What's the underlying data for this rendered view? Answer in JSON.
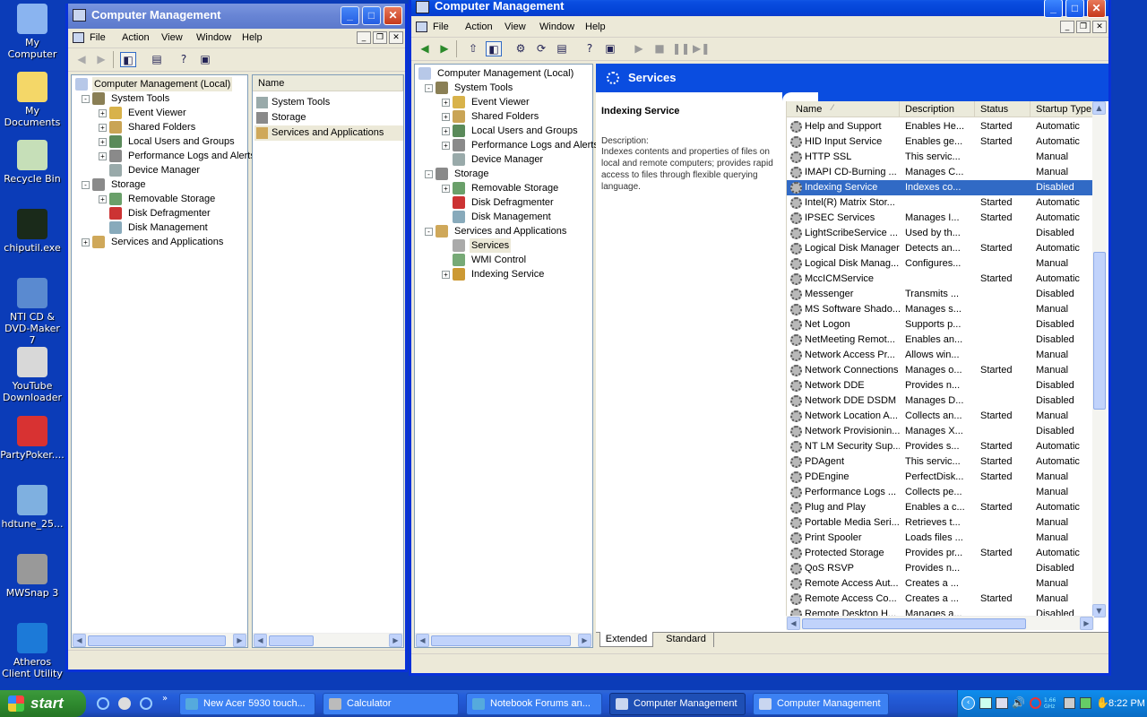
{
  "desktop": {
    "icons": [
      {
        "label": "My Computer"
      },
      {
        "label": "My Documents"
      },
      {
        "label": "Recycle Bin"
      },
      {
        "label": "chiputil.exe"
      },
      {
        "label": "NTI CD & DVD-Maker 7"
      },
      {
        "label": "YouTube Downloader"
      },
      {
        "label": "PartyPoker...."
      },
      {
        "label": "hdtune_25..."
      },
      {
        "label": "MWSnap 3"
      },
      {
        "label": "Atheros Client Utility"
      }
    ]
  },
  "window_back": {
    "title": "Computer Management",
    "menu": [
      "File",
      "Action",
      "View",
      "Window",
      "Help"
    ],
    "tree": [
      {
        "label": "Computer Management (Local)",
        "level": 0,
        "exp": ""
      },
      {
        "label": "System Tools",
        "level": 1,
        "exp": "-"
      },
      {
        "label": "Event Viewer",
        "level": 2,
        "exp": "+"
      },
      {
        "label": "Shared Folders",
        "level": 2,
        "exp": "+"
      },
      {
        "label": "Local Users and Groups",
        "level": 2,
        "exp": "+"
      },
      {
        "label": "Performance Logs and Alerts",
        "level": 2,
        "exp": "+"
      },
      {
        "label": "Device Manager",
        "level": 2,
        "exp": ""
      },
      {
        "label": "Storage",
        "level": 1,
        "exp": "-"
      },
      {
        "label": "Removable Storage",
        "level": 2,
        "exp": "+"
      },
      {
        "label": "Disk Defragmenter",
        "level": 2,
        "exp": ""
      },
      {
        "label": "Disk Management",
        "level": 2,
        "exp": ""
      },
      {
        "label": "Services and Applications",
        "level": 1,
        "exp": "+"
      }
    ],
    "list_header": "Name",
    "list": [
      "System Tools",
      "Storage",
      "Services and Applications"
    ]
  },
  "window_front": {
    "title": "Computer Management",
    "menu": [
      "File",
      "Action",
      "View",
      "Window",
      "Help"
    ],
    "tree": [
      {
        "label": "Computer Management (Local)",
        "level": 0,
        "exp": ""
      },
      {
        "label": "System Tools",
        "level": 1,
        "exp": "-"
      },
      {
        "label": "Event Viewer",
        "level": 2,
        "exp": "+"
      },
      {
        "label": "Shared Folders",
        "level": 2,
        "exp": "+"
      },
      {
        "label": "Local Users and Groups",
        "level": 2,
        "exp": "+"
      },
      {
        "label": "Performance Logs and Alerts",
        "level": 2,
        "exp": "+"
      },
      {
        "label": "Device Manager",
        "level": 2,
        "exp": ""
      },
      {
        "label": "Storage",
        "level": 1,
        "exp": "-"
      },
      {
        "label": "Removable Storage",
        "level": 2,
        "exp": "+"
      },
      {
        "label": "Disk Defragmenter",
        "level": 2,
        "exp": ""
      },
      {
        "label": "Disk Management",
        "level": 2,
        "exp": ""
      },
      {
        "label": "Services and Applications",
        "level": 1,
        "exp": "-"
      },
      {
        "label": "Services",
        "level": 2,
        "exp": ""
      },
      {
        "label": "WMI Control",
        "level": 2,
        "exp": ""
      },
      {
        "label": "Indexing Service",
        "level": 2,
        "exp": "+"
      }
    ],
    "services_title": "Services",
    "detail": {
      "name": "Indexing Service",
      "desc_label": "Description:",
      "desc_text": "Indexes contents and properties of files on local and remote computers; provides rapid access to files through flexible querying language."
    },
    "columns": [
      "Name",
      "Description",
      "Status",
      "Startup Type"
    ],
    "services": [
      [
        "Help and Support",
        "Enables He...",
        "Started",
        "Automatic"
      ],
      [
        "HID Input Service",
        "Enables ge...",
        "Started",
        "Automatic"
      ],
      [
        "HTTP SSL",
        "This servic...",
        "",
        "Manual"
      ],
      [
        "IMAPI CD-Burning ...",
        "Manages C...",
        "",
        "Manual"
      ],
      [
        "Indexing Service",
        "Indexes co...",
        "",
        "Disabled"
      ],
      [
        "Intel(R) Matrix Stor...",
        "",
        "Started",
        "Automatic"
      ],
      [
        "IPSEC Services",
        "Manages I...",
        "Started",
        "Automatic"
      ],
      [
        "LightScribeService ...",
        "Used by th...",
        "",
        "Disabled"
      ],
      [
        "Logical Disk Manager",
        "Detects an...",
        "Started",
        "Automatic"
      ],
      [
        "Logical Disk Manag...",
        "Configures...",
        "",
        "Manual"
      ],
      [
        "MccICMService",
        "",
        "Started",
        "Automatic"
      ],
      [
        "Messenger",
        "Transmits ...",
        "",
        "Disabled"
      ],
      [
        "MS Software Shado...",
        "Manages s...",
        "",
        "Manual"
      ],
      [
        "Net Logon",
        "Supports p...",
        "",
        "Disabled"
      ],
      [
        "NetMeeting Remot...",
        "Enables an...",
        "",
        "Disabled"
      ],
      [
        "Network Access Pr...",
        "Allows win...",
        "",
        "Manual"
      ],
      [
        "Network Connections",
        "Manages o...",
        "Started",
        "Manual"
      ],
      [
        "Network DDE",
        "Provides n...",
        "",
        "Disabled"
      ],
      [
        "Network DDE DSDM",
        "Manages D...",
        "",
        "Disabled"
      ],
      [
        "Network Location A...",
        "Collects an...",
        "Started",
        "Manual"
      ],
      [
        "Network Provisionin...",
        "Manages X...",
        "",
        "Disabled"
      ],
      [
        "NT LM Security Sup...",
        "Provides s...",
        "Started",
        "Automatic"
      ],
      [
        "PDAgent",
        "This servic...",
        "Started",
        "Automatic"
      ],
      [
        "PDEngine",
        "PerfectDisk...",
        "Started",
        "Manual"
      ],
      [
        "Performance Logs ...",
        "Collects pe...",
        "",
        "Manual"
      ],
      [
        "Plug and Play",
        "Enables a c...",
        "Started",
        "Automatic"
      ],
      [
        "Portable Media Seri...",
        "Retrieves t...",
        "",
        "Manual"
      ],
      [
        "Print Spooler",
        "Loads files ...",
        "",
        "Manual"
      ],
      [
        "Protected Storage",
        "Provides pr...",
        "Started",
        "Automatic"
      ],
      [
        "QoS RSVP",
        "Provides n...",
        "",
        "Disabled"
      ],
      [
        "Remote Access Aut...",
        "Creates a ...",
        "",
        "Manual"
      ],
      [
        "Remote Access Co...",
        "Creates a ...",
        "Started",
        "Manual"
      ],
      [
        "Remote Desktop H...",
        "Manages a...",
        "",
        "Disabled"
      ]
    ],
    "tabs": [
      "Extended",
      "Standard"
    ]
  },
  "taskbar": {
    "start": "start",
    "tasks": [
      {
        "label": "New Acer 5930 touch..."
      },
      {
        "label": "Calculator"
      },
      {
        "label": "Notebook Forums an..."
      },
      {
        "label": "Computer Management"
      },
      {
        "label": "Computer Management"
      }
    ],
    "clock": "8:22 PM",
    "tray_cpu": "1.66 GHz"
  },
  "colors": {
    "accent": "#316ac5",
    "desktop": "#0b3cb8",
    "services_banner": "#0a4de0"
  }
}
